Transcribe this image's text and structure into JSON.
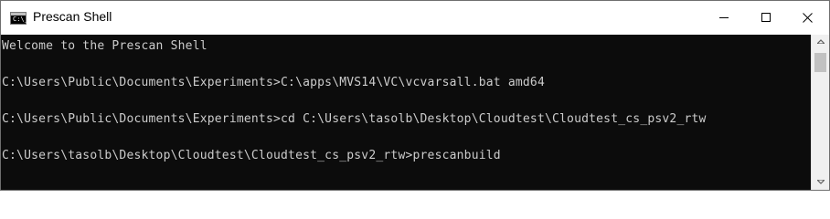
{
  "window": {
    "title": "Prescan Shell",
    "icon": "console-app-icon",
    "icon_prompt": "C:\\_",
    "controls": {
      "minimize": "minimize-icon",
      "maximize": "maximize-icon",
      "close": "close-icon"
    }
  },
  "console": {
    "text_color": "#cccccc",
    "background": "#0c0c0c",
    "lines": [
      "Welcome to the Prescan Shell",
      "",
      "C:\\Users\\Public\\Documents\\Experiments>C:\\apps\\MVS14\\VC\\vcvarsall.bat amd64",
      "",
      "C:\\Users\\Public\\Documents\\Experiments>cd C:\\Users\\tasolb\\Desktop\\Cloudtest\\Cloudtest_cs_psv2_rtw",
      "",
      "C:\\Users\\tasolb\\Desktop\\Cloudtest\\Cloudtest_cs_psv2_rtw>prescanbuild",
      "",
      ""
    ]
  },
  "scrollbar": {
    "up_arrow": "scroll-up-arrow-icon",
    "down_arrow": "scroll-down-arrow-icon"
  }
}
